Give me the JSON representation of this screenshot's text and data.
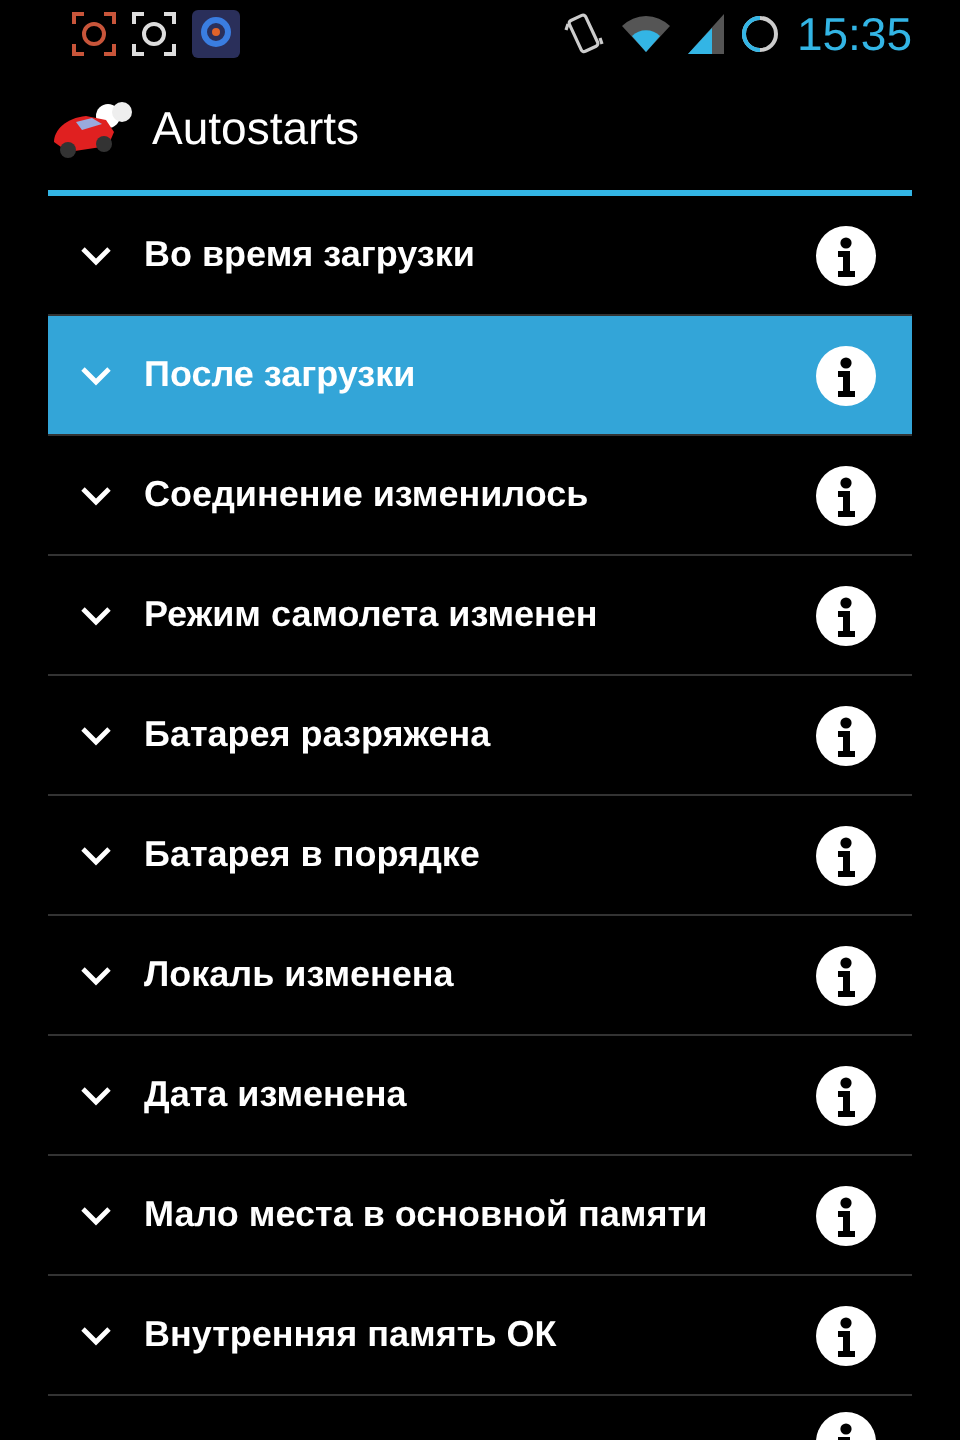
{
  "status_bar": {
    "time": "15:35"
  },
  "app_bar": {
    "title": "Autostarts"
  },
  "rows": [
    {
      "label": "Во время загрузки",
      "selected": false
    },
    {
      "label": "После загрузки",
      "selected": true
    },
    {
      "label": "Соединение изменилось",
      "selected": false
    },
    {
      "label": "Режим самолета изменен",
      "selected": false
    },
    {
      "label": "Батарея разряжена",
      "selected": false
    },
    {
      "label": "Батарея в порядке",
      "selected": false
    },
    {
      "label": "Локаль изменена",
      "selected": false
    },
    {
      "label": "Дата изменена",
      "selected": false
    },
    {
      "label": "Мало места в основной памяти",
      "selected": false
    },
    {
      "label": "Внутренняя память ОК",
      "selected": false
    }
  ]
}
